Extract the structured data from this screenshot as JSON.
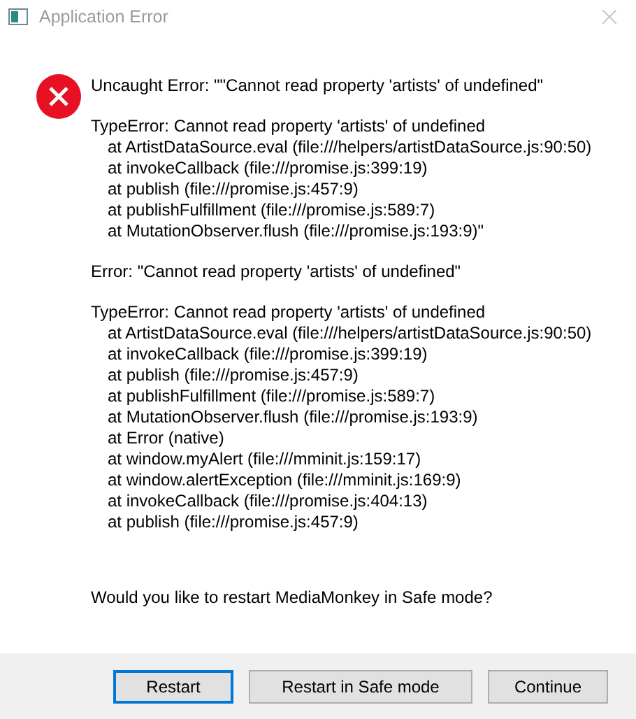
{
  "window": {
    "title": "Application Error"
  },
  "message_blocks": [
    {
      "heading": "Uncaught Error: \"\"Cannot read property 'artists' of undefined\""
    },
    {
      "heading": "TypeError: Cannot read property 'artists' of undefined",
      "stack": [
        "at ArtistDataSource.eval (file:///helpers/artistDataSource.js:90:50)",
        "at invokeCallback (file:///promise.js:399:19)",
        "at publish (file:///promise.js:457:9)",
        "at publishFulfillment (file:///promise.js:589:7)",
        "at MutationObserver.flush (file:///promise.js:193:9)\""
      ]
    },
    {
      "heading": "Error: \"Cannot read property 'artists' of undefined\""
    },
    {
      "heading": "TypeError: Cannot read property 'artists' of undefined",
      "stack": [
        "at ArtistDataSource.eval (file:///helpers/artistDataSource.js:90:50)",
        "at invokeCallback (file:///promise.js:399:19)",
        "at publish (file:///promise.js:457:9)",
        "at publishFulfillment (file:///promise.js:589:7)",
        "at MutationObserver.flush (file:///promise.js:193:9)",
        "at Error (native)",
        "at window.myAlert (file:///mminit.js:159:17)",
        "at window.alertException (file:///mminit.js:169:9)",
        "at invokeCallback (file:///promise.js:404:13)",
        "at publish (file:///promise.js:457:9)"
      ]
    }
  ],
  "question": "Would you like to restart MediaMonkey in Safe mode?",
  "buttons": [
    {
      "label": "Restart",
      "selected": true
    },
    {
      "label": "Restart in Safe mode",
      "selected": false
    },
    {
      "label": "Continue",
      "selected": false
    }
  ]
}
